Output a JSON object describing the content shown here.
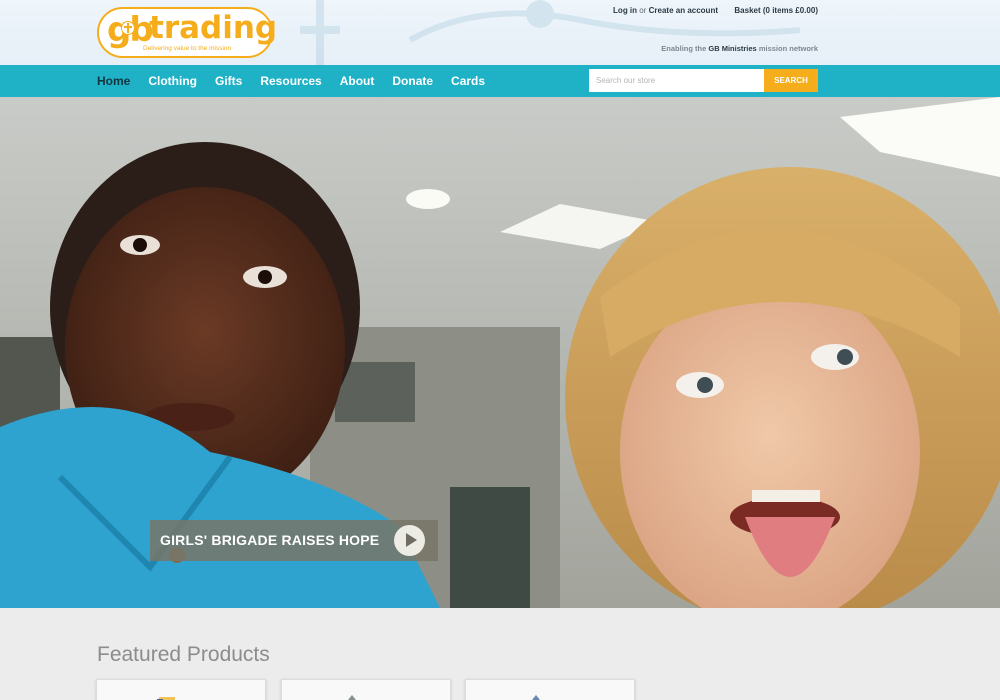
{
  "header": {
    "logo": {
      "mark": "gb",
      "name": "trading",
      "tagline": "Delivering value to the mission"
    },
    "login": "Log in",
    "or": "or",
    "create_account": "Create an account",
    "basket": "Basket (0 items £0.00)",
    "tagline_prefix": "Enabling the",
    "tagline_bold": "GB Ministries",
    "tagline_suffix": "mission network"
  },
  "nav": {
    "items": [
      {
        "label": "Home",
        "active": true
      },
      {
        "label": "Clothing"
      },
      {
        "label": "Gifts"
      },
      {
        "label": "Resources"
      },
      {
        "label": "About"
      },
      {
        "label": "Donate"
      },
      {
        "label": "Cards"
      }
    ],
    "search_placeholder": "Search our store",
    "search_button": "SEARCH"
  },
  "hero": {
    "caption": "GIRLS' BRIGADE RAISES HOPE",
    "play_icon": "play-icon"
  },
  "featured": {
    "title": "Featured Products",
    "cards": [
      "product-1",
      "product-2",
      "product-3"
    ]
  },
  "colors": {
    "accent": "#1fb2c7",
    "brand": "#f6ad1b",
    "header_bg": "#e9f1f8"
  }
}
